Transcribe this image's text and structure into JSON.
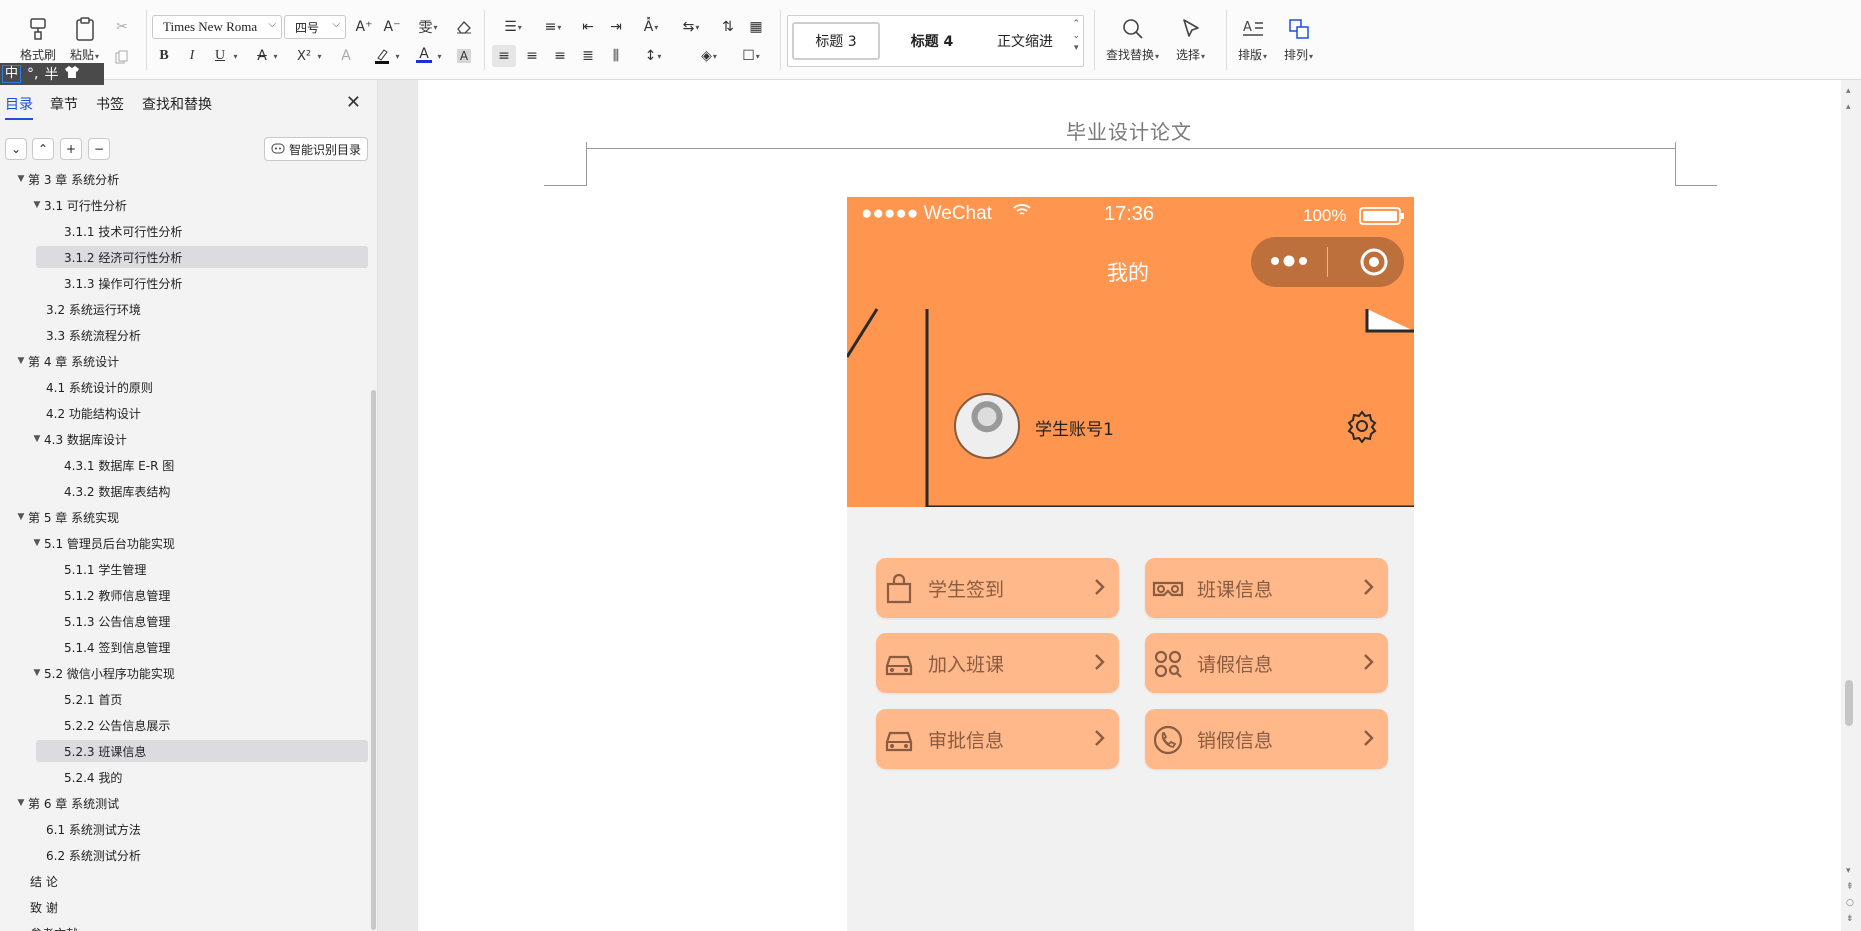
{
  "ribbon": {
    "format_painter": "格式刷",
    "paste": "粘贴",
    "font_name": "Times New Roma",
    "font_size": "四号",
    "styles": [
      "标题 3",
      "标题 4",
      "正文缩进"
    ],
    "find_replace": "查找替换",
    "select": "选择",
    "layout": "排版",
    "arrange": "排列",
    "bold": "B",
    "italic": "I",
    "underline": "U",
    "superscript": "X²",
    "highlight_letter": "A",
    "font_color_letter": "A",
    "char_shade": "A"
  },
  "ime": {
    "mode": "中",
    "punct": "°,",
    "width": "半"
  },
  "nav": {
    "tabs": [
      "目录",
      "章节",
      "书签",
      "查找和替换"
    ],
    "smart_toc": "智能识别目录",
    "items": [
      {
        "text": "第 3 章  系统分析",
        "level": 0,
        "arrow": true
      },
      {
        "text": "3.1 可行性分析",
        "level": 1,
        "arrow": true
      },
      {
        "text": "3.1.1 技术可行性分析",
        "level": 2
      },
      {
        "text": "3.1.2 经济可行性分析",
        "level": 2,
        "highlight": true
      },
      {
        "text": "3.1.3 操作可行性分析",
        "level": 2
      },
      {
        "text": "3.2 系统运行环境",
        "level": 1
      },
      {
        "text": "3.3 系统流程分析",
        "level": 1
      },
      {
        "text": "第 4 章  系统设计",
        "level": 0,
        "arrow": true
      },
      {
        "text": "4.1  系统设计的原则",
        "level": 1
      },
      {
        "text": "4.2  功能结构设计",
        "level": 1
      },
      {
        "text": "4.3  数据库设计",
        "level": 1,
        "arrow": true
      },
      {
        "text": "4.3.1  数据库 E-R 图",
        "level": 2
      },
      {
        "text": "4.3.2  数据库表结构",
        "level": 2
      },
      {
        "text": "第 5 章  系统实现",
        "level": 0,
        "arrow": true
      },
      {
        "text": "5.1 管理员后台功能实现",
        "level": 1,
        "arrow": true
      },
      {
        "text": "5.1.1  学生管理",
        "level": 2
      },
      {
        "text": "5.1.2  教师信息管理",
        "level": 2
      },
      {
        "text": "5.1.3  公告信息管理",
        "level": 2
      },
      {
        "text": "5.1.4  签到信息管理",
        "level": 2
      },
      {
        "text": "5.2  微信小程序功能实现",
        "level": 1,
        "arrow": true
      },
      {
        "text": "5.2.1  首页",
        "level": 2
      },
      {
        "text": "5.2.2  公告信息展示",
        "level": 2
      },
      {
        "text": "5.2.3  班课信息",
        "level": 2,
        "highlight": true
      },
      {
        "text": "5.2.4  我的",
        "level": 2
      },
      {
        "text": "第 6 章  系统测试",
        "level": 0,
        "arrow": true
      },
      {
        "text": "6.1 系统测试方法",
        "level": 1
      },
      {
        "text": "6.2  系统测试分析",
        "level": 1
      },
      {
        "text": "结    论",
        "level": 0
      },
      {
        "text": "致    谢",
        "level": 0
      },
      {
        "text": "参考文献",
        "level": 0
      }
    ]
  },
  "document": {
    "header_title": "毕业设计论文"
  },
  "phone": {
    "carrier": "●●●●● WeChat",
    "time": "17:36",
    "battery": "100%",
    "page_title": "我的",
    "username": "学生账号1",
    "features": [
      {
        "label": "学生签到",
        "icon": "bag-icon"
      },
      {
        "label": "班课信息",
        "icon": "vr-glasses-icon"
      },
      {
        "label": "加入班课",
        "icon": "car-icon"
      },
      {
        "label": "请假信息",
        "icon": "grid-search-icon"
      },
      {
        "label": "审批信息",
        "icon": "car-icon"
      },
      {
        "label": "销假信息",
        "icon": "phone-icon"
      }
    ]
  },
  "colors": {
    "accent_blue": "#1f4fd6",
    "phone_orange": "#ff964f",
    "card_orange": "#ffb88a",
    "capsule_brown": "#bd6f3c"
  }
}
